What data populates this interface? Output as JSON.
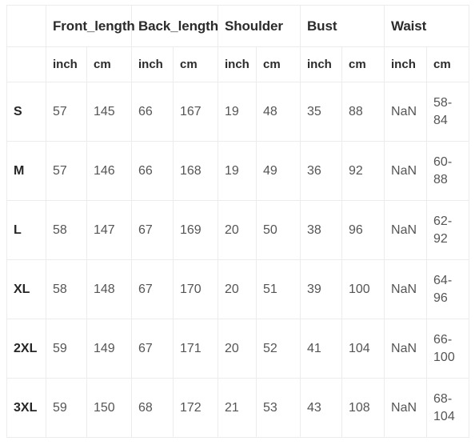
{
  "table": {
    "corner_label": "",
    "group_headers": [
      {
        "label": "Front_length",
        "span": 2
      },
      {
        "label": "Back_length",
        "span": 2
      },
      {
        "label": "Shoulder",
        "span": 2
      },
      {
        "label": "Bust",
        "span": 2
      },
      {
        "label": "Waist",
        "span": 2
      }
    ],
    "unit_headers": [
      "inch",
      "cm",
      "inch",
      "cm",
      "inch",
      "cm",
      "inch",
      "cm",
      "inch",
      "cm"
    ],
    "rows": [
      {
        "size": "S",
        "front_length_inch": "57",
        "front_length_cm": "145",
        "back_length_inch": "66",
        "back_length_cm": "167",
        "shoulder_inch": "19",
        "shoulder_cm": "48",
        "bust_inch": "35",
        "bust_cm": "88",
        "waist_inch": "NaN",
        "waist_cm": "58-84"
      },
      {
        "size": "M",
        "front_length_inch": "57",
        "front_length_cm": "146",
        "back_length_inch": "66",
        "back_length_cm": "168",
        "shoulder_inch": "19",
        "shoulder_cm": "49",
        "bust_inch": "36",
        "bust_cm": "92",
        "waist_inch": "NaN",
        "waist_cm": "60-88"
      },
      {
        "size": "L",
        "front_length_inch": "58",
        "front_length_cm": "147",
        "back_length_inch": "67",
        "back_length_cm": "169",
        "shoulder_inch": "20",
        "shoulder_cm": "50",
        "bust_inch": "38",
        "bust_cm": "96",
        "waist_inch": "NaN",
        "waist_cm": "62-92"
      },
      {
        "size": "XL",
        "front_length_inch": "58",
        "front_length_cm": "148",
        "back_length_inch": "67",
        "back_length_cm": "170",
        "shoulder_inch": "20",
        "shoulder_cm": "51",
        "bust_inch": "39",
        "bust_cm": "100",
        "waist_inch": "NaN",
        "waist_cm": "64-96"
      },
      {
        "size": "2XL",
        "front_length_inch": "59",
        "front_length_cm": "149",
        "back_length_inch": "67",
        "back_length_cm": "171",
        "shoulder_inch": "20",
        "shoulder_cm": "52",
        "bust_inch": "41",
        "bust_cm": "104",
        "waist_inch": "NaN",
        "waist_cm": "66-100"
      },
      {
        "size": "3XL",
        "front_length_inch": "59",
        "front_length_cm": "150",
        "back_length_inch": "68",
        "back_length_cm": "172",
        "shoulder_inch": "21",
        "shoulder_cm": "53",
        "bust_inch": "43",
        "bust_cm": "108",
        "waist_inch": "NaN",
        "waist_cm": "68-104"
      }
    ]
  },
  "colors": {
    "border": "#ececec",
    "header_text": "#2b2b2b",
    "body_text": "#555555",
    "size_text": "#262626",
    "background": "#ffffff"
  }
}
